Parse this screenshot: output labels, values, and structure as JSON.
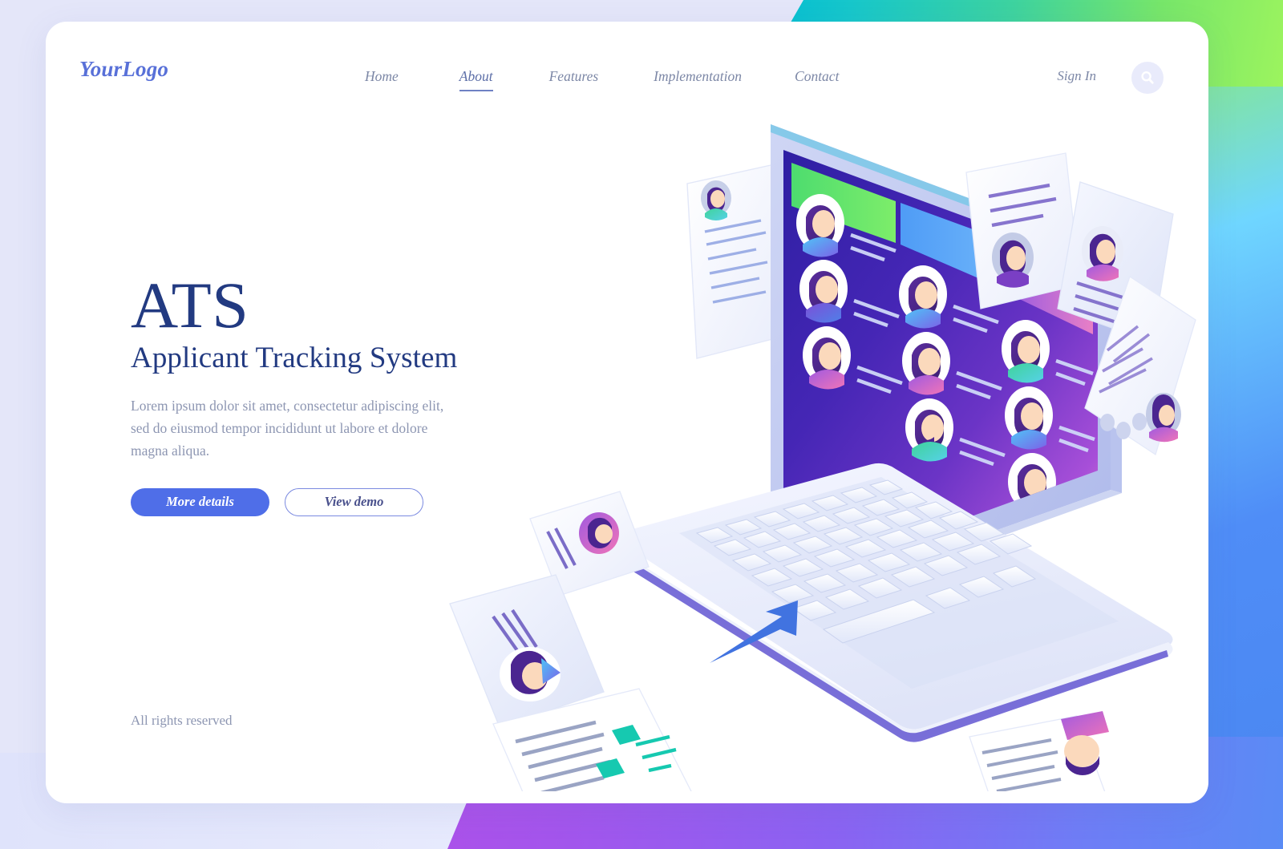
{
  "page": {
    "background_color": "#e4e6f9",
    "card_color": "#ffffff",
    "accent_blue": "#4f6ee8",
    "heading_color": "#223a81",
    "muted_text_color": "#8d96b2"
  },
  "header": {
    "logo": "YourLogo",
    "nav": [
      {
        "label": "Home",
        "active": false
      },
      {
        "label": "About",
        "active": true
      },
      {
        "label": "Features",
        "active": false
      },
      {
        "label": "Implementation",
        "active": false
      },
      {
        "label": "Contact",
        "active": false
      }
    ],
    "sign_in_label": "Sign In",
    "search_icon": "search-icon"
  },
  "hero": {
    "title": "ATS",
    "subtitle": "Applicant Tracking System",
    "paragraph": "Lorem ipsum dolor sit amet, consectetur adipiscing elit, sed do eiusmod tempor incididunt ut labore et dolore magna aliqua.",
    "primary_button": "More details",
    "secondary_button": "View demo"
  },
  "footer": {
    "rights": "All rights reserved"
  },
  "illustration": {
    "name": "isometric-laptop-applicant-tracking",
    "device": "laptop",
    "screen_gradient": [
      "#3421a8",
      "#5b2fbd",
      "#a250d8",
      "#f089c9"
    ],
    "screen_header_tabs": [
      {
        "name": "tab-green",
        "color": "#54e06a"
      },
      {
        "name": "tab-blue",
        "color": "#56a9f7"
      },
      {
        "name": "tab-purple",
        "color": "#a35de0"
      }
    ],
    "candidate_rows": 9,
    "cursor_icon": "arrow-cursor-icon",
    "documents": [
      {
        "name": "resume-card-left-top",
        "has_avatar": true
      },
      {
        "name": "resume-card-left-mid",
        "has_avatar": true
      },
      {
        "name": "resume-card-bottom",
        "has_avatar": true,
        "accent": "#16c9b0"
      },
      {
        "name": "resume-card-right-upper",
        "has_avatar": true
      },
      {
        "name": "resume-card-right-top",
        "has_avatar": true
      },
      {
        "name": "resume-card-right-side",
        "has_avatar": true
      },
      {
        "name": "resume-card-bottom-right",
        "has_avatar": true
      },
      {
        "name": "resume-card-far-left",
        "has_avatar": true
      }
    ]
  }
}
